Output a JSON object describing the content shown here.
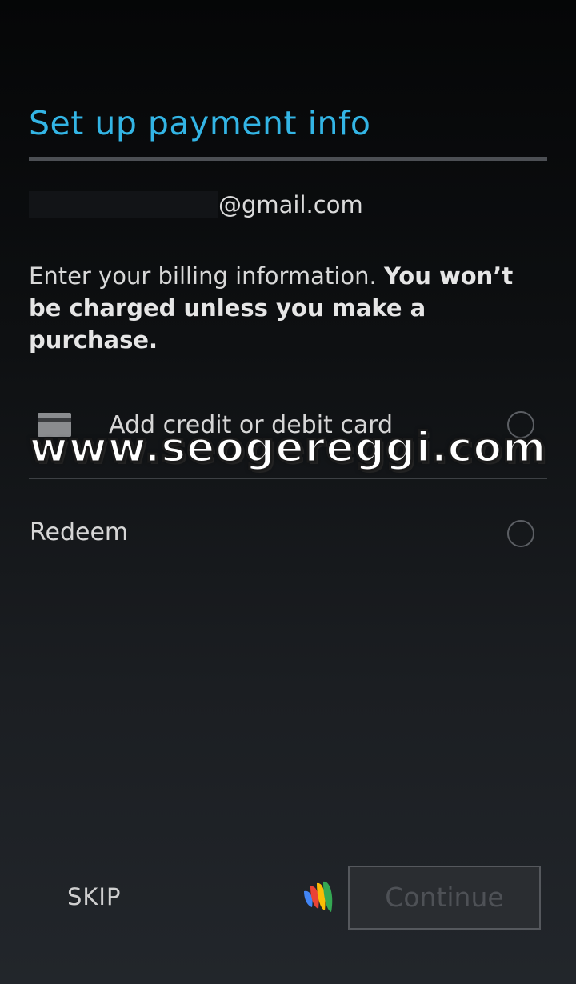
{
  "header": {
    "title": "Set up payment info"
  },
  "account": {
    "email_domain": "@gmail.com"
  },
  "billing": {
    "text_plain": "Enter your billing information. ",
    "text_bold": "You won’t be charged unless you make a purchase."
  },
  "options": {
    "card": {
      "label": "Add credit or debit card",
      "icon": "credit-card-icon",
      "selected": false
    },
    "redeem": {
      "label": "Redeem",
      "selected": false
    }
  },
  "watermark": {
    "text": "www.seogereggi.com"
  },
  "footer": {
    "skip_label": "SKIP",
    "wallet_icon": "google-wallet-icon",
    "continue_label": "Continue",
    "continue_enabled": false
  },
  "colors": {
    "accent": "#33b5e5",
    "background_top": "#050607",
    "background_bottom": "#22262b"
  }
}
